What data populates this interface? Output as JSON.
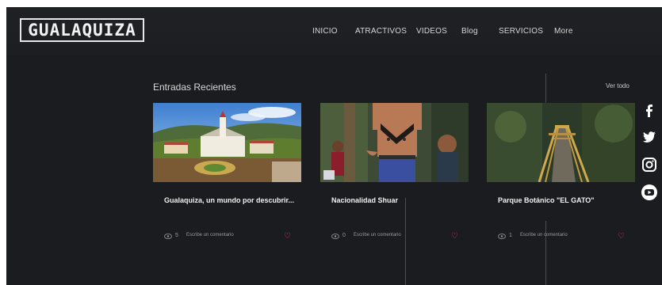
{
  "header": {
    "logo": "GUALAQUIZA",
    "nav": [
      "INICIO",
      "ATRACTIVOS",
      "VIDEOS",
      "Blog",
      "SERVICIOS",
      "More"
    ]
  },
  "blog": {
    "section_title": "Entradas Recientes",
    "see_all": "Ver todo",
    "posts": [
      {
        "title": "Gualaquiza, un mundo por descubrir...",
        "views": "5",
        "comment_label": "Escribe un comentario"
      },
      {
        "title": "Nacionalidad Shuar",
        "views": "0",
        "comment_label": "Escribe un comentario"
      },
      {
        "title": "Parque Botánico \"EL GATO\"",
        "views": "1",
        "comment_label": "Escribe un comentario"
      }
    ]
  },
  "social": [
    "facebook-icon",
    "twitter-icon",
    "instagram-icon",
    "youtube-icon"
  ],
  "colors": {
    "background": "#1a1c1f",
    "accent_heart": "#e0455a",
    "text": "#f0f0f0"
  }
}
